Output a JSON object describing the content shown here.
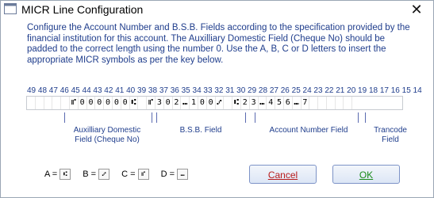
{
  "window": {
    "title": "MICR Line Configuration"
  },
  "instructions": "Configure the Account Number and B.S.B. Fields according to the specification provided by the financial institution for this account.  The Auxilliary Domestic Field (Cheque No) should be padded to the correct length using the number 0.  Use the A, B, C or D letters to insert the appropriate MICR symbols as per the key below.",
  "position_numbers": "49 48 47 46 45 44 43 42 41 40 39 38 37 36 35 34 33 32 31 30 29 28 27 26 25 24 23 22 21 20 19 18 17 16 15 14",
  "micr_cells": [
    "",
    "",
    "",
    "",
    "",
    "C",
    "0",
    "0",
    "0",
    "0",
    "0",
    "0",
    "A",
    "",
    "C",
    "3",
    "0",
    "2",
    "D",
    "1",
    "0",
    "0",
    "B",
    "",
    "A",
    "2",
    "3",
    "D",
    "4",
    "5",
    "6",
    "D",
    "7",
    "",
    "",
    "",
    "",
    ""
  ],
  "fields": {
    "aux": "Auxilliary Domestic Field (Cheque No)",
    "bsb": "B.S.B. Field",
    "account": "Account Number Field",
    "trancode": "Trancode Field"
  },
  "key": {
    "a_label": "A =",
    "b_label": "B =",
    "c_label": "C =",
    "d_label": "D =",
    "a_symbol": "⑆",
    "b_symbol": "⑇",
    "c_symbol": "⑈",
    "d_symbol": "⑉"
  },
  "buttons": {
    "cancel": "Cancel",
    "ok": "OK"
  },
  "colors": {
    "text_blue": "#1f3d8c",
    "cancel_red": "#b81b1b",
    "ok_green": "#1a8b1a"
  }
}
